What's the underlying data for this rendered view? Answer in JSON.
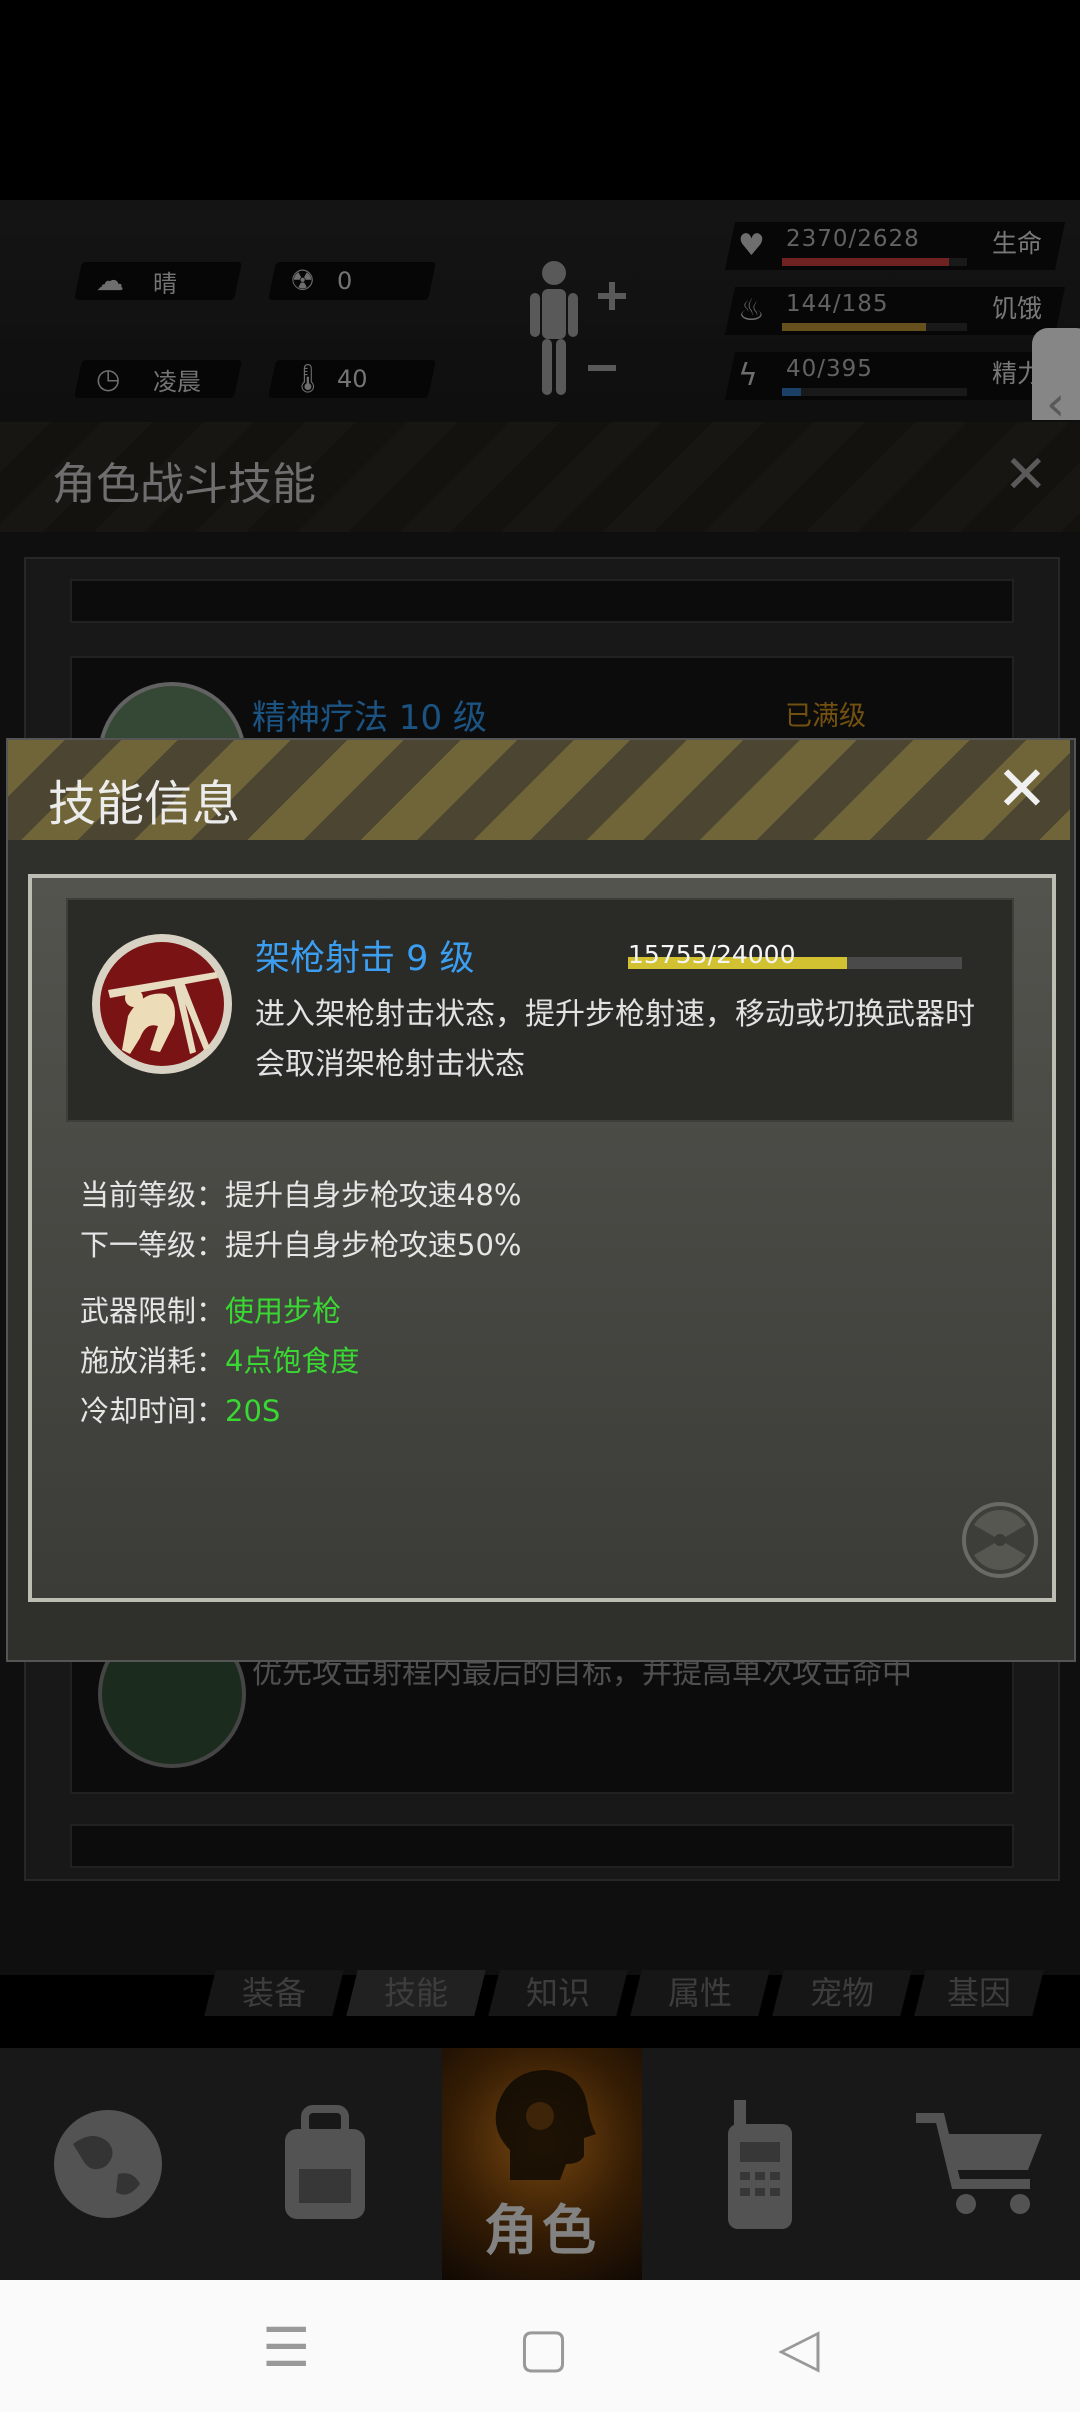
{
  "hud": {
    "weather": {
      "icon": "cloud-sun-icon",
      "label": "晴"
    },
    "radiation": {
      "icon": "radiation-icon",
      "value": "0"
    },
    "time": {
      "icon": "clock-icon",
      "label": "凌晨"
    },
    "temperature": {
      "icon": "thermometer-icon",
      "value": "40"
    },
    "stats": [
      {
        "icon": "heart-icon",
        "value": "2370/2628",
        "name": "生命",
        "fraction": 0.9,
        "color": "#c23a3a"
      },
      {
        "icon": "stomach-icon",
        "value": "144/185",
        "name": "饥饿",
        "fraction": 0.78,
        "color": "#b08a35"
      },
      {
        "icon": "brain-lightning-icon",
        "value": "40/395",
        "name": "精力",
        "fraction": 0.1,
        "color": "#2e6fb4"
      }
    ]
  },
  "skill_list": {
    "title": "角色战斗技能",
    "item1": {
      "name": "精神疗法 10 级",
      "status": "已满级"
    },
    "item2": {
      "desc": "优先攻击射程内最后的目标，并提高单次攻击命中"
    }
  },
  "skill_info": {
    "title": "技能信息",
    "skill_name": "架枪射击 9 级",
    "xp_text": "15755/24000",
    "xp_fraction": 0.656,
    "description": "进入架枪射击状态，提升步枪射速，移动或切换武器时会取消架枪射击状态",
    "rows": {
      "current_label": "当前等级：",
      "current_value": "提升自身步枪攻速48%",
      "next_label": "下一等级：",
      "next_value": "提升自身步枪攻速50%",
      "weapon_label": "武器限制：",
      "weapon_value": "使用步枪",
      "cost_label": "施放消耗：",
      "cost_value": "4点饱食度",
      "cooldown_label": "冷却时间：",
      "cooldown_value": "20S"
    }
  },
  "subtabs": [
    "装备",
    "技能",
    "知识",
    "属性",
    "宠物",
    "基因"
  ],
  "nav": {
    "items": [
      "globe-icon",
      "backpack-icon",
      "role-head-icon",
      "radio-icon",
      "cart-icon"
    ],
    "role_label": "角色"
  },
  "colors": {
    "accent_blue": "#3b9ef0",
    "green": "#39d832",
    "orange": "#c58b1a"
  }
}
